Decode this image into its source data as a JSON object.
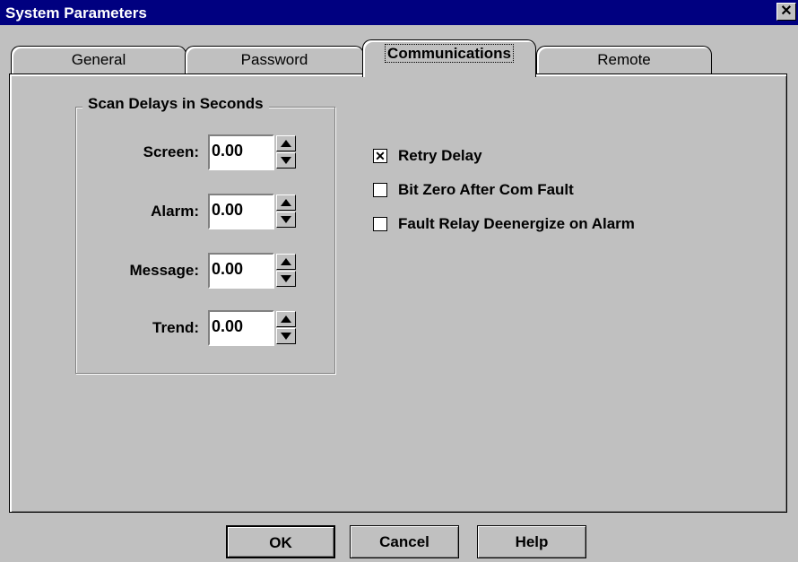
{
  "window": {
    "title": "System Parameters",
    "close_glyph": "✕"
  },
  "tabs": [
    {
      "label": "General"
    },
    {
      "label": "Password"
    },
    {
      "label": "Communications",
      "active": true
    },
    {
      "label": "Remote"
    }
  ],
  "scan_delays": {
    "title": "Scan Delays in Seconds",
    "rows": [
      {
        "label": "Screen:",
        "value": "0.00"
      },
      {
        "label": "Alarm:",
        "value": "0.00"
      },
      {
        "label": "Message:",
        "value": "0.00"
      },
      {
        "label": "Trend:",
        "value": "0.00"
      }
    ]
  },
  "options": [
    {
      "label": "Retry Delay",
      "checked": true,
      "mark": "✕"
    },
    {
      "label": "Bit Zero After Com Fault",
      "checked": false,
      "mark": ""
    },
    {
      "label": "Fault Relay Deenergize on Alarm",
      "checked": false,
      "mark": ""
    }
  ],
  "buttons": {
    "ok": "OK",
    "cancel": "Cancel",
    "help": "Help"
  },
  "colors": {
    "titlebar": "#000080",
    "face": "#c0c0c0"
  },
  "icons": {
    "close": "close-icon",
    "up": "spin-up-icon",
    "down": "spin-down-icon",
    "check": "checkmark-icon"
  }
}
